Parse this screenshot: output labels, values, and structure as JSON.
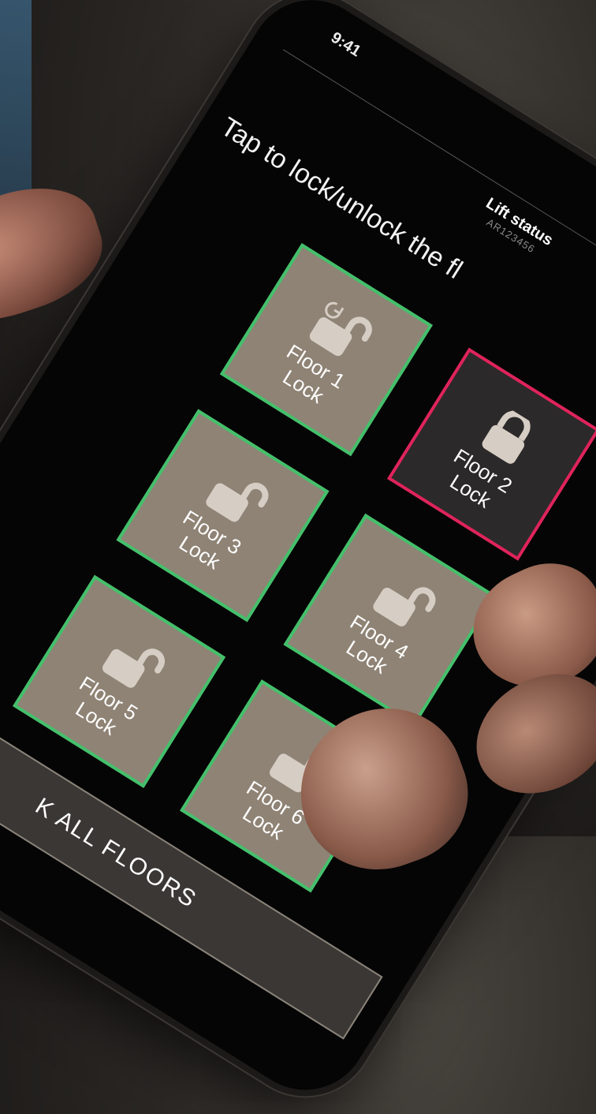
{
  "status_bar": {
    "time": "9:41"
  },
  "header": {
    "title": "Lift status",
    "lift_id": "AR123456"
  },
  "instruction": "Tap to lock/unlock the fl",
  "floors": [
    {
      "floor_label": "Floor 1",
      "action_label": "Lock",
      "state": "unlocked"
    },
    {
      "floor_label": "Floor 2",
      "action_label": "Lock",
      "state": "locked"
    },
    {
      "floor_label": "Floor 3",
      "action_label": "Lock",
      "state": "unlocked"
    },
    {
      "floor_label": "Floor 4",
      "action_label": "Lock",
      "state": "unlocked"
    },
    {
      "floor_label": "Floor 5",
      "action_label": "Lock",
      "state": "unlocked"
    },
    {
      "floor_label": "Floor 6",
      "action_label": "Lock",
      "state": "unlocked"
    }
  ],
  "lock_all_button": "K ALL FLOORS",
  "colors": {
    "unlocked_tile": "#8f8375",
    "unlocked_border": "#43c06b",
    "locked_tile": "#2c292a",
    "locked_border": "#e0235b",
    "icon": "#d6cec4"
  },
  "icons": {
    "unlocked": "padlock-open-icon",
    "locked": "padlock-closed-icon",
    "refresh": "refresh-icon"
  }
}
